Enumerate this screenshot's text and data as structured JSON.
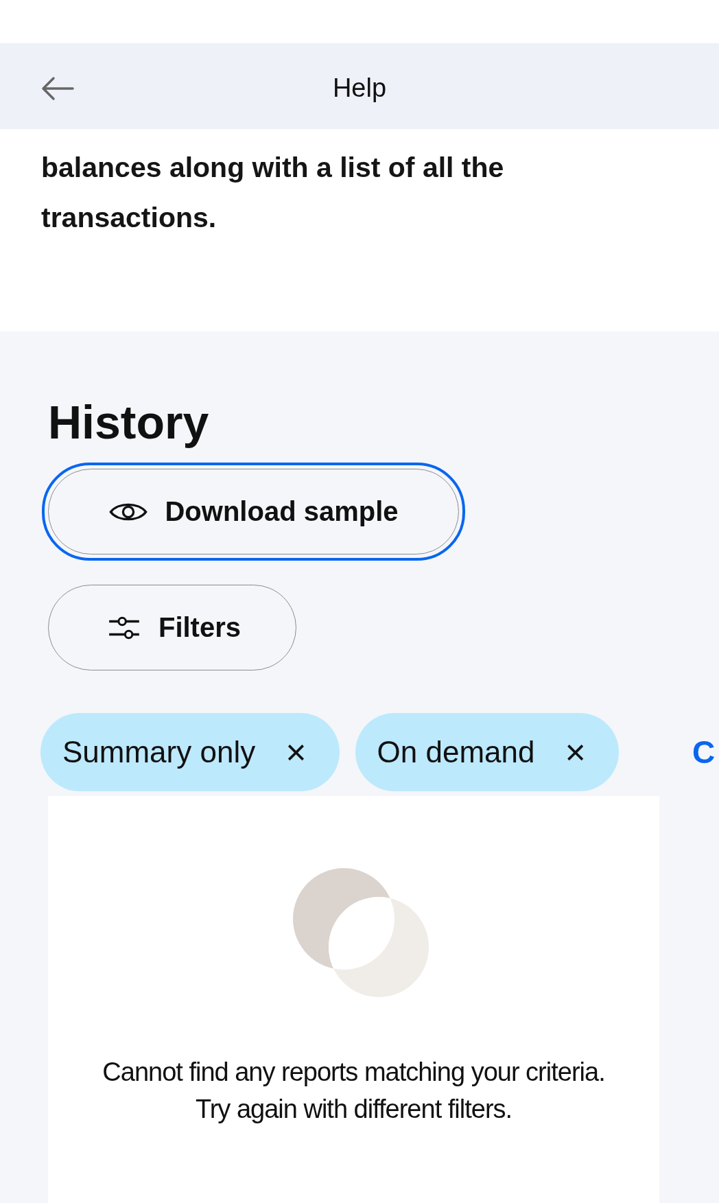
{
  "header": {
    "title": "Help"
  },
  "intro": {
    "text": "balances along with a list of all the transactions."
  },
  "history": {
    "title": "History",
    "buttons": [
      {
        "kind": "preview",
        "label": "Download sample",
        "focused": true
      },
      {
        "kind": "filters",
        "label": "Filters",
        "focused": false
      }
    ],
    "chips": [
      {
        "label": "Summary only",
        "remove": "×"
      },
      {
        "label": "On demand",
        "remove": "×"
      }
    ],
    "clear_link": "C",
    "empty_state": {
      "message": "Cannot find any reports matching your criteria. Try again with different filters."
    }
  }
}
